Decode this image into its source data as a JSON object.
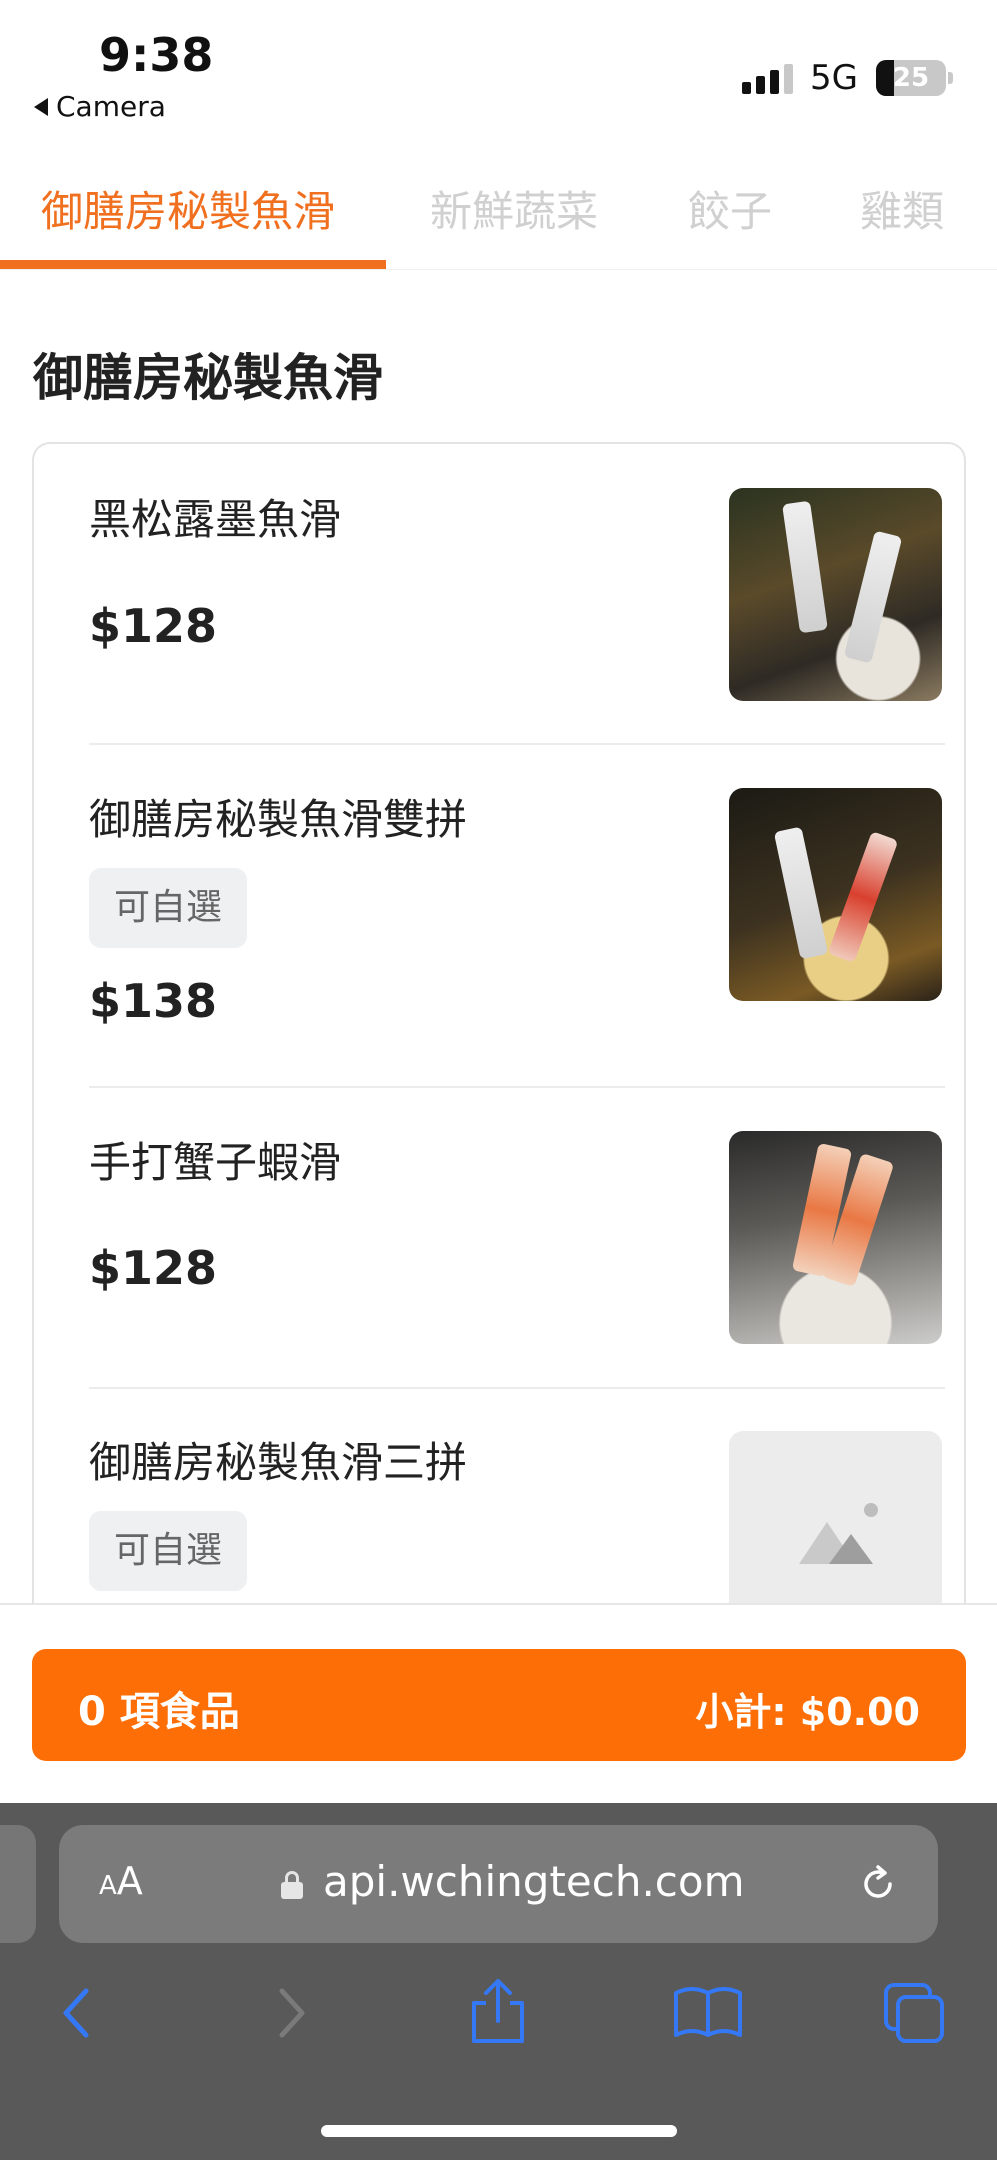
{
  "status_bar": {
    "time": "9:38",
    "back_label": "Camera",
    "network": "5G",
    "battery": "25",
    "battery_level": 0.25
  },
  "tabs": [
    {
      "label": "御膳房秘製魚滑",
      "active": true
    },
    {
      "label": "新鮮蔬菜",
      "active": false
    },
    {
      "label": "餃子",
      "active": false
    },
    {
      "label": "雞類",
      "active": false
    }
  ],
  "section": {
    "title": "御膳房秘製魚滑"
  },
  "items": [
    {
      "name": "黑松露墨魚滑",
      "price": "$128",
      "badge": "",
      "image": "photo"
    },
    {
      "name": "御膳房秘製魚滑雙拼",
      "price": "$138",
      "badge": "可自選",
      "image": "photo"
    },
    {
      "name": "手打蟹子蝦滑",
      "price": "$128",
      "badge": "",
      "image": "photo"
    },
    {
      "name": "御膳房秘製魚滑三拼",
      "price": "",
      "badge": "可自選",
      "image": "placeholder-image-icon"
    }
  ],
  "cart": {
    "count_label": "0 項食品",
    "subtotal_label": "小計: $0.00",
    "accent_color": "#fd6f06"
  },
  "browser": {
    "aa_label": "AA",
    "url": "api.wchingtech.com",
    "icons": [
      "lock-icon",
      "reload-icon",
      "back-icon",
      "forward-icon",
      "share-icon",
      "bookmarks-icon",
      "tabs-icon"
    ]
  },
  "colors": {
    "accent": "#f07020",
    "ios_blue": "#3478f6"
  }
}
